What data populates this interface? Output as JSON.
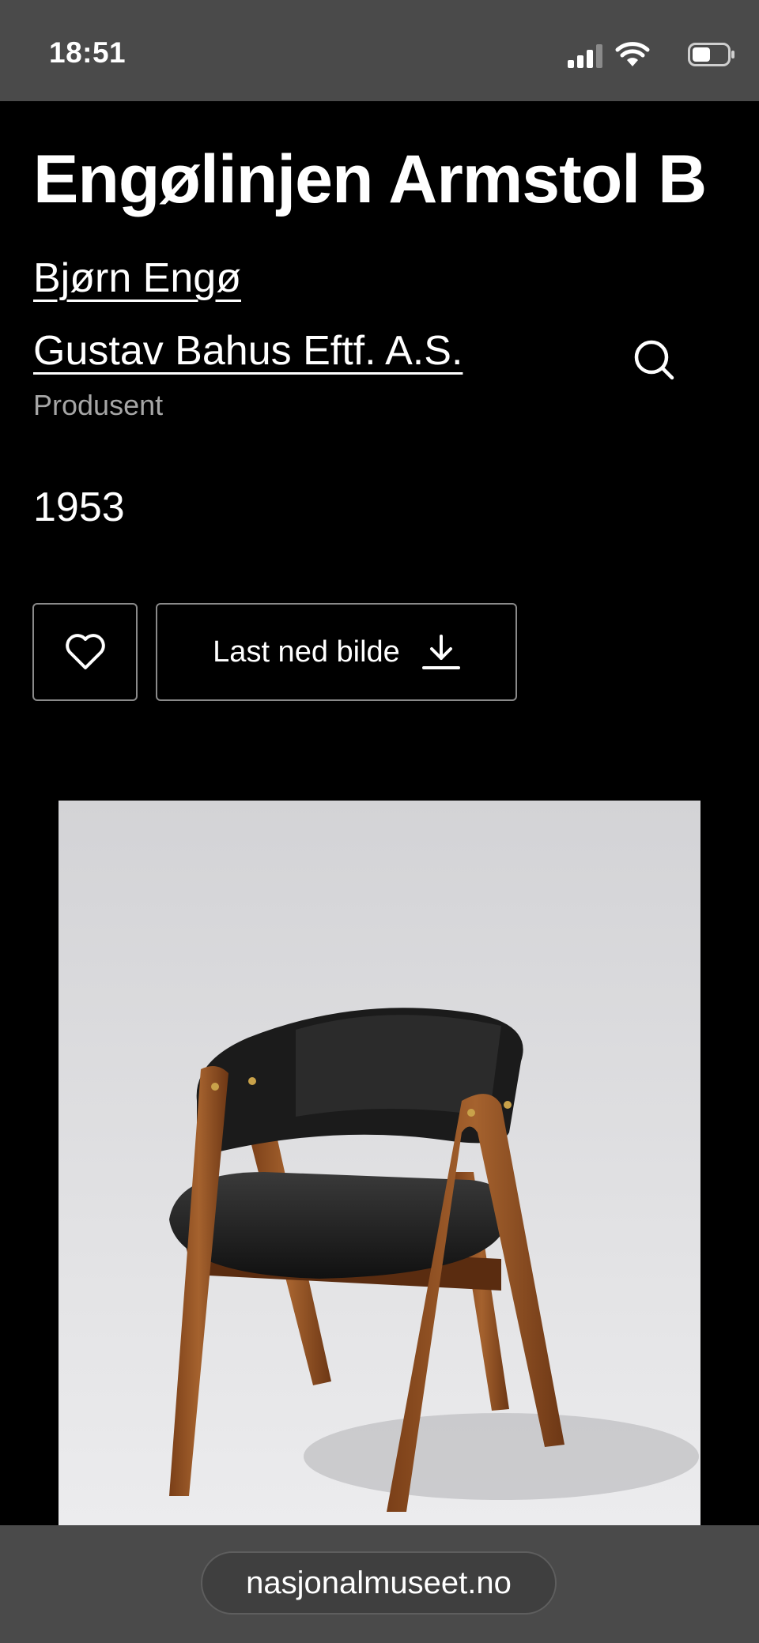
{
  "status_bar": {
    "time": "18:51"
  },
  "artwork": {
    "title": "Engølinjen Armstol B",
    "creator": "Bjørn Engø",
    "producer": "Gustav Bahus Eftf. A.S.",
    "producer_role": "Produsent",
    "year": "1953"
  },
  "actions": {
    "download_label": "Last ned bilde"
  },
  "browser": {
    "url": "nasjonalmuseet.no"
  },
  "colors": {
    "background": "#000000",
    "chrome": "#4a4a4a",
    "text": "#ffffff",
    "muted_text": "#a6a6a6"
  },
  "icons": [
    "signal-icon",
    "wifi-icon",
    "battery-icon",
    "search-icon",
    "heart-icon",
    "download-icon"
  ]
}
